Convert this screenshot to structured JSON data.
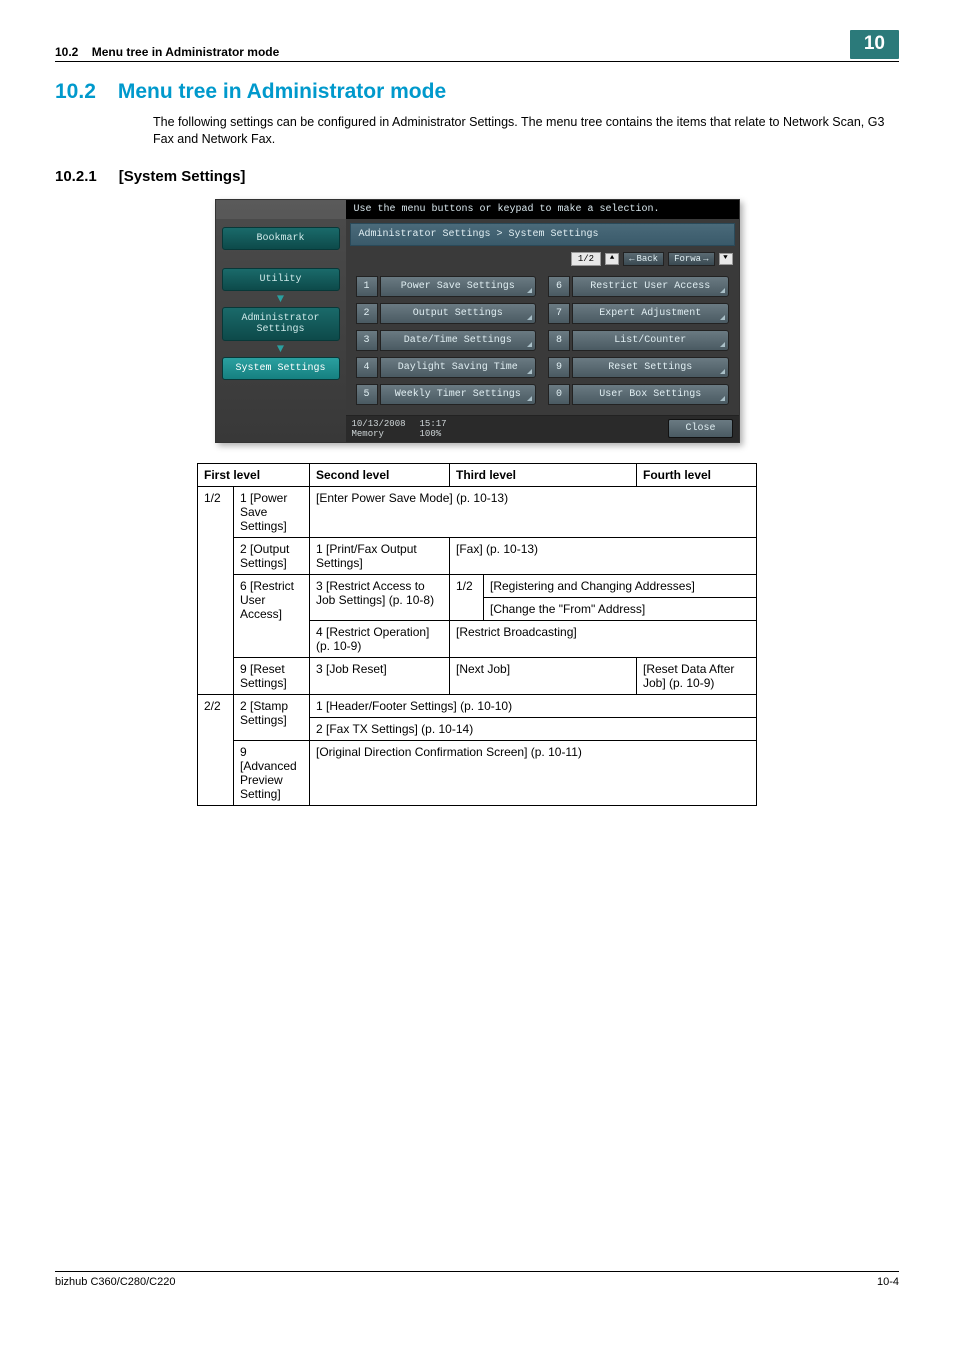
{
  "header": {
    "section_num": "10.2",
    "section_title": "Menu tree in Administrator mode",
    "chapter_badge": "10"
  },
  "h1": {
    "num": "10.2",
    "title": "Menu tree in Administrator mode"
  },
  "intro": "The following settings can be configured in Administrator Settings. The menu tree contains the items that relate to Network Scan, G3 Fax and Network Fax.",
  "h2": {
    "num": "10.2.1",
    "title": "[System Settings]"
  },
  "shot": {
    "prompt": "Use the menu buttons or keypad to make a selection.",
    "side": {
      "bookmark": "Bookmark",
      "utility": "Utility",
      "admin": "Administrator\nSettings",
      "system": "System Settings"
    },
    "breadcrumb": "Administrator Settings > System Settings",
    "page_ind": "1/2",
    "back_label": "Back",
    "forward_label": "Forwa",
    "items": [
      {
        "n": "1",
        "label": "Power Save Settings"
      },
      {
        "n": "2",
        "label": "Output Settings"
      },
      {
        "n": "3",
        "label": "Date/Time Settings"
      },
      {
        "n": "4",
        "label": "Daylight Saving Time"
      },
      {
        "n": "5",
        "label": "Weekly Timer Settings"
      },
      {
        "n": "6",
        "label": "Restrict User Access"
      },
      {
        "n": "7",
        "label": "Expert Adjustment"
      },
      {
        "n": "8",
        "label": "List/Counter"
      },
      {
        "n": "9",
        "label": "Reset Settings"
      },
      {
        "n": "0",
        "label": "User Box Settings"
      }
    ],
    "footer": {
      "date": "10/13/2008",
      "time": "15:17",
      "mem_label": "Memory",
      "mem_val": "100%",
      "close": "Close"
    }
  },
  "table": {
    "headers": {
      "c1": "First level",
      "c2": "Second level",
      "c3": "Third level",
      "c4": "Fourth level"
    },
    "r1": {
      "page": "1/2",
      "first": "1 [Power Save Settings]",
      "second": "[Enter Power Save Mode] (p. 10-13)"
    },
    "r2": {
      "first": "2 [Output Settings]",
      "second": "1 [Print/Fax Output Settings]",
      "third": "[Fax] (p. 10-13)"
    },
    "r3": {
      "first": "6 [Restrict User Access]",
      "second": "3 [Restrict Access to Job Settings] (p. 10-8)",
      "third_pg": "1/2",
      "fourth_a": "[Registering and Changing Addresses]",
      "fourth_b": "[Change the \"From\" Address]"
    },
    "r4": {
      "second": "4 [Restrict Operation] (p. 10-9)",
      "third": "[Restrict Broadcasting]"
    },
    "r5": {
      "first": "9 [Reset Settings]",
      "second": "3 [Job Reset]",
      "third": "[Next Job]",
      "fourth": "[Reset Data After Job] (p. 10-9)"
    },
    "r6": {
      "page": "2/2",
      "first": "2 [Stamp Settings]",
      "second_a": "1 [Header/Footer Settings] (p. 10-10)",
      "second_b": "2 [Fax TX Settings] (p. 10-14)"
    },
    "r7": {
      "first": "9 [Advanced Preview Setting]",
      "second": "[Original Direction Confirmation Screen] (p. 10-11)"
    }
  },
  "footer": {
    "model": "bizhub C360/C280/C220",
    "page": "10-4"
  }
}
